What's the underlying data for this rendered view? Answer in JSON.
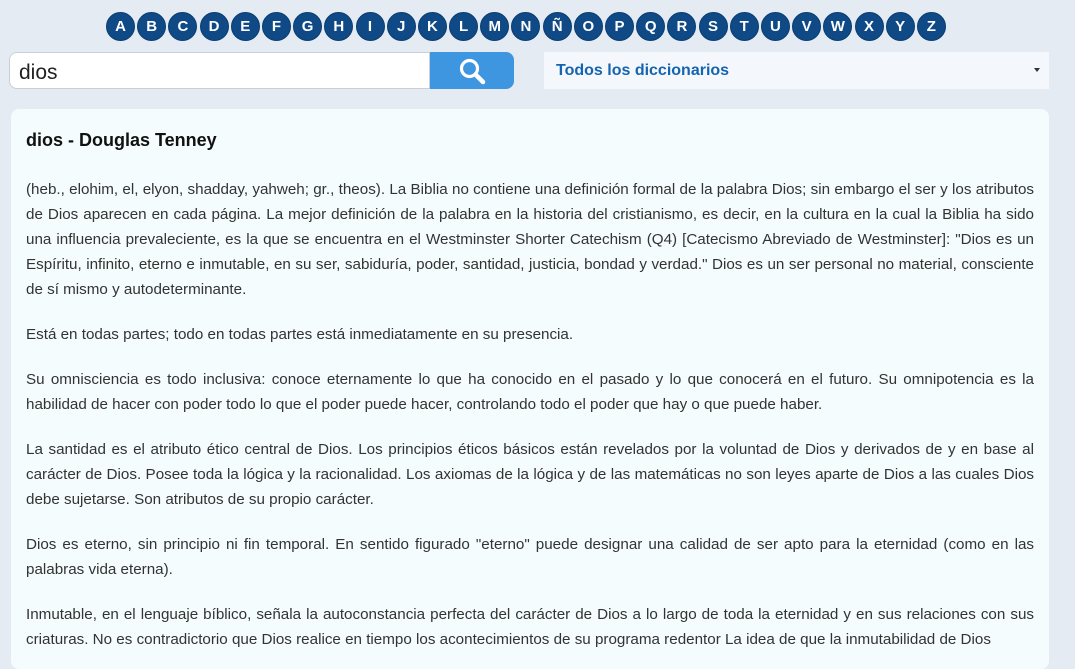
{
  "alphabet": [
    "A",
    "B",
    "C",
    "D",
    "E",
    "F",
    "G",
    "H",
    "I",
    "J",
    "K",
    "L",
    "M",
    "N",
    "Ñ",
    "O",
    "P",
    "Q",
    "R",
    "S",
    "T",
    "U",
    "V",
    "W",
    "X",
    "Y",
    "Z"
  ],
  "search": {
    "value": "dios",
    "button_icon": "search-icon"
  },
  "dictionary_select": {
    "selected": "Todos los diccionarios",
    "icon": "caret-down-icon"
  },
  "entry": {
    "title": "dios - Douglas Tenney",
    "paragraphs": [
      "(heb., elohim, el, elyon, shadday, yahweh; gr., theos). La Biblia no contiene una definición formal de la palabra Dios; sin embargo el ser y los atributos de Dios aparecen en cada página. La mejor definición de la palabra en la historia del cristianismo, es decir, en la cultura en la cual la Biblia ha sido una influencia prevaleciente, es la que se encuentra en el Westminster Shorter Catechism (Q4) [Catecismo Abreviado de Westminster]: \"Dios es un Espíritu, infinito, eterno e inmutable, en su ser, sabiduría, poder, santidad, justicia, bondad y verdad.\" Dios es un ser personal no material, consciente de sí mismo y autodeterminante.",
      "Está en todas partes; todo en todas partes está inmediatamente en su presencia.",
      "Su omnisciencia es todo inclusiva: conoce eternamente lo que ha conocido en el pasado y lo que conocerá en el futuro. Su omnipotencia es la habilidad de hacer con poder todo lo que el poder puede hacer, controlando todo el poder que hay o que puede haber.",
      "La santidad es el atributo ético central de Dios. Los principios éticos básicos están revelados por la voluntad de Dios y derivados de y en base al carácter de Dios. Posee toda la lógica y la racionalidad. Los axiomas de la lógica y de las matemáticas no son leyes aparte de Dios a las cuales Dios debe sujetarse. Son atributos de su propio carácter.",
      "Dios es eterno, sin principio ni fin temporal. En sentido figurado \"eterno\" puede designar una calidad de ser apto para la eternidad (como en las palabras vida eterna).",
      "Inmutable, en el lenguaje bíblico, señala la autoconstancia perfecta del carácter de Dios a lo largo de toda la eternidad y en sus relaciones con sus criaturas. No es contradictorio que Dios realice en tiempo los acontecimientos de su programa redentor La idea de que la inmutabilidad de Dios"
    ]
  }
}
